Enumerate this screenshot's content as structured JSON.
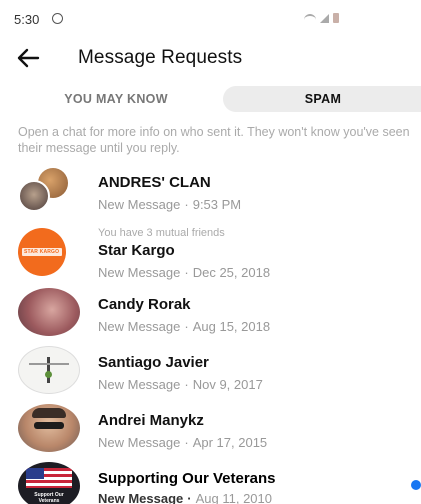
{
  "status_bar": {
    "time": "5:30"
  },
  "header": {
    "title": "Message Requests"
  },
  "tabs": [
    {
      "label": "YOU MAY KNOW",
      "active": false
    },
    {
      "label": "SPAM",
      "active": true
    }
  ],
  "info": "Open a chat for more info on who sent it. They won't know you've seen their message until you reply.",
  "requests": [
    {
      "name": "ANDRES' CLAN",
      "preview": "New Message",
      "date": "9:53 PM",
      "mutual": "",
      "unread": false
    },
    {
      "name": "Star Kargo",
      "preview": "New Message",
      "date": "Dec 25, 2018",
      "mutual": "You have 3 mutual friends",
      "unread": false,
      "logo_text": "STAR KARGO"
    },
    {
      "name": "Candy Rorak",
      "preview": "New Message",
      "date": "Aug 15, 2018",
      "mutual": "",
      "unread": false
    },
    {
      "name": "Santiago Javier",
      "preview": "New Message",
      "date": "Nov 9, 2017",
      "mutual": "",
      "unread": false
    },
    {
      "name": "Andrei Manykz",
      "preview": "New Message",
      "date": "Apr 17, 2015",
      "mutual": "",
      "unread": false
    },
    {
      "name": "Supporting Our Veterans",
      "preview": "New Message",
      "date": "Aug 11, 2010",
      "mutual": "",
      "unread": true,
      "logo_text": "Support Our Veterans"
    }
  ],
  "colors": {
    "accent": "#1877f2",
    "star_kargo": "#f26b1d"
  }
}
